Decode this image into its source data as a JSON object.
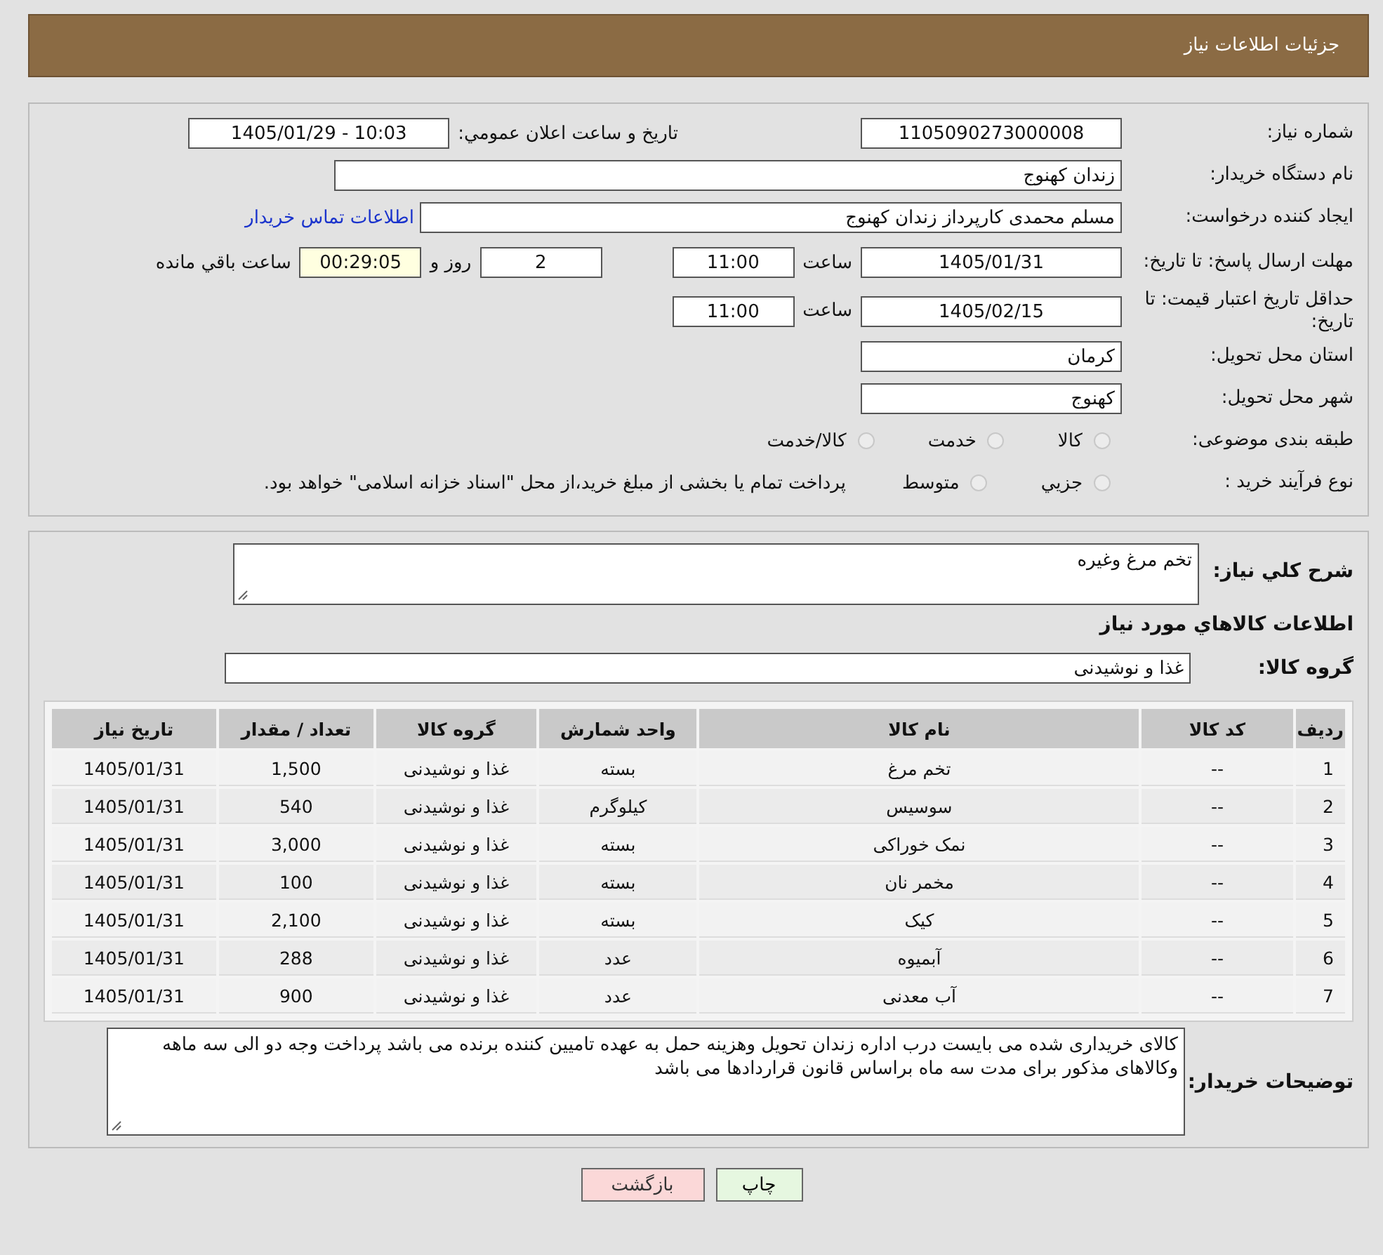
{
  "header": {
    "title": "جزئیات اطلاعات نیاز"
  },
  "form": {
    "need_number": {
      "label": "شماره نیاز:",
      "value": "1105090273000008"
    },
    "announce": {
      "label": "تاریخ و ساعت اعلان عمومي:",
      "value": "1405/01/29 - 10:03"
    },
    "buyer_org": {
      "label": "نام دستگاه خریدار:",
      "value": "زندان کهنوج"
    },
    "requester": {
      "label": "ایجاد کننده درخواست:",
      "value": "مسلم محمدی کارپرداز زندان کهنوج",
      "link": "اطلاعات تماس خریدار"
    },
    "reply_deadline": {
      "label": "مهلت ارسال پاسخ: تا تاریخ:",
      "date": "1405/01/31",
      "time_label": "ساعت",
      "time": "11:00",
      "days": "2",
      "days_label": "روز و",
      "remaining": "00:29:05",
      "remaining_label": "ساعت باقي مانده"
    },
    "price_validity": {
      "label": "حداقل تاریخ اعتبار قیمت: تا تاریخ:",
      "date": "1405/02/15",
      "time_label": "ساعت",
      "time": "11:00"
    },
    "province": {
      "label": "استان محل تحویل:",
      "value": "کرمان"
    },
    "city": {
      "label": "شهر محل تحویل:",
      "value": "کهنوج"
    },
    "category": {
      "label": "طبقه بندی موضوعی:",
      "options": [
        {
          "label": "کالا",
          "selected": false
        },
        {
          "label": "خدمت",
          "selected": false
        },
        {
          "label": "کالا/خدمت",
          "selected": false
        }
      ]
    },
    "process": {
      "label": "نوع فرآیند خرید :",
      "options": [
        {
          "label": "جزيي",
          "selected": false
        },
        {
          "label": "متوسط",
          "selected": false
        }
      ],
      "note": "پرداخت تمام یا بخشی از مبلغ خرید،از محل \"اسناد خزانه اسلامی\" خواهد بود."
    }
  },
  "details": {
    "description": {
      "label": "شرح کلي نیاز:",
      "value": "تخم مرغ وغیره"
    },
    "section_title": "اطلاعات کالاهاي مورد نیاز",
    "goods_group": {
      "label": "گروه کالا:",
      "value": "غذا و نوشیدنی"
    },
    "table": {
      "columns": [
        "ردیف",
        "کد کالا",
        "نام کالا",
        "واحد شمارش",
        "گروه کالا",
        "تعداد / مقدار",
        "تاریخ نیاز"
      ],
      "rows": [
        [
          "1",
          "--",
          "تخم مرغ",
          "بسته",
          "غذا و نوشیدنی",
          "1,500",
          "1405/01/31"
        ],
        [
          "2",
          "--",
          "سوسیس",
          "کیلوگرم",
          "غذا و نوشیدنی",
          "540",
          "1405/01/31"
        ],
        [
          "3",
          "--",
          "نمک خوراکی",
          "بسته",
          "غذا و نوشیدنی",
          "3,000",
          "1405/01/31"
        ],
        [
          "4",
          "--",
          "مخمر نان",
          "بسته",
          "غذا و نوشیدنی",
          "100",
          "1405/01/31"
        ],
        [
          "5",
          "--",
          "کیک",
          "بسته",
          "غذا و نوشیدنی",
          "2,100",
          "1405/01/31"
        ],
        [
          "6",
          "--",
          "آبمیوه",
          "عدد",
          "غذا و نوشیدنی",
          "288",
          "1405/01/31"
        ],
        [
          "7",
          "--",
          "آب معدنی",
          "عدد",
          "غذا و نوشیدنی",
          "900",
          "1405/01/31"
        ]
      ]
    },
    "buyer_notes": {
      "label": "توضیحات خریدار:",
      "value": "کالای خریداری شده می بایست درب اداره زندان تحویل وهزینه حمل به عهده تامیین کننده برنده می باشد پرداخت وجه دو الی سه ماهه وکالاهای مذکور برای مدت سه ماه براساس قانون قراردادها می باشد"
    }
  },
  "buttons": [
    {
      "label": "چاپ",
      "kind": "print"
    },
    {
      "label": "بازگشت",
      "kind": "back"
    }
  ]
}
